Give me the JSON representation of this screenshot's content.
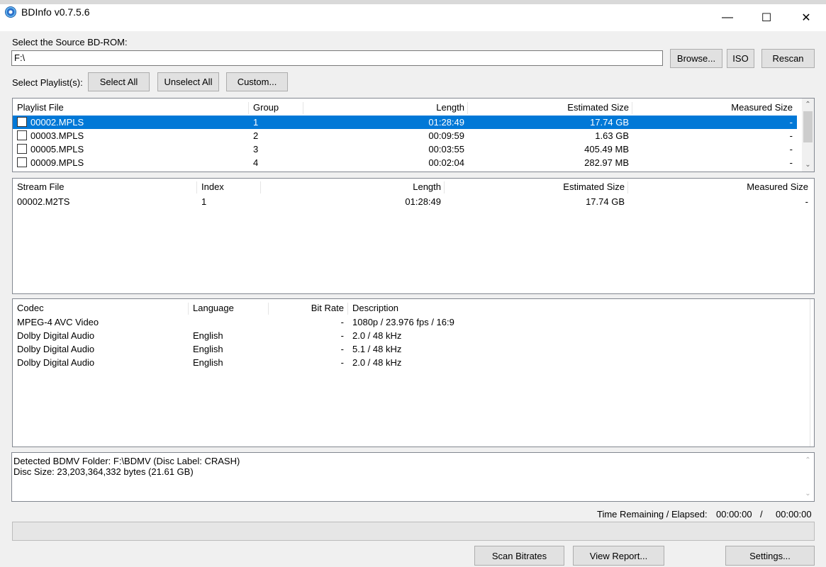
{
  "window": {
    "title": "BDInfo v0.7.5.6",
    "minimize_glyph": "—",
    "maximize_glyph": "☐",
    "close_glyph": "✕"
  },
  "source": {
    "label": "Select the Source BD-ROM:",
    "value": "F:\\",
    "browse_label": "Browse...",
    "iso_label": "ISO",
    "rescan_label": "Rescan"
  },
  "playlist_select": {
    "label": "Select Playlist(s):",
    "select_all_label": "Select All",
    "unselect_all_label": "Unselect All",
    "custom_label": "Custom..."
  },
  "playlists": {
    "columns": [
      "Playlist File",
      "Group",
      "Length",
      "Estimated Size",
      "Measured Size"
    ],
    "rows": [
      {
        "file": "00002.MPLS",
        "group": "1",
        "length": "01:28:49",
        "estimated": "17.74 GB",
        "measured": "-",
        "selected": true
      },
      {
        "file": "00003.MPLS",
        "group": "2",
        "length": "00:09:59",
        "estimated": "1.63 GB",
        "measured": "-",
        "selected": false
      },
      {
        "file": "00005.MPLS",
        "group": "3",
        "length": "00:03:55",
        "estimated": "405.49 MB",
        "measured": "-",
        "selected": false
      },
      {
        "file": "00009.MPLS",
        "group": "4",
        "length": "00:02:04",
        "estimated": "282.97 MB",
        "measured": "-",
        "selected": false
      }
    ]
  },
  "streams": {
    "columns": [
      "Stream File",
      "Index",
      "Length",
      "Estimated Size",
      "Measured Size"
    ],
    "rows": [
      {
        "file": "00002.M2TS",
        "index": "1",
        "length": "01:28:49",
        "estimated": "17.74 GB",
        "measured": "-"
      }
    ]
  },
  "codecs": {
    "columns": [
      "Codec",
      "Language",
      "Bit Rate",
      "Description"
    ],
    "rows": [
      {
        "codec": "MPEG-4 AVC Video",
        "language": "",
        "bitrate": "-",
        "description": "1080p / 23.976 fps / 16:9"
      },
      {
        "codec": "Dolby Digital Audio",
        "language": "English",
        "bitrate": "-",
        "description": "2.0 / 48 kHz"
      },
      {
        "codec": "Dolby Digital Audio",
        "language": "English",
        "bitrate": "-",
        "description": "5.1 / 48 kHz"
      },
      {
        "codec": "Dolby Digital Audio",
        "language": "English",
        "bitrate": "-",
        "description": "2.0 / 48 kHz"
      }
    ]
  },
  "log": {
    "lines": [
      "Detected BDMV Folder: F:\\BDMV (Disc Label: CRASH)",
      "Disc Size: 23,203,364,332 bytes (21.61 GB)"
    ]
  },
  "status": {
    "time_label": "Time Remaining / Elapsed:",
    "remaining": "00:00:00",
    "separator": "/",
    "elapsed": "00:00:00",
    "progress": 0
  },
  "footer": {
    "scan_label": "Scan Bitrates",
    "report_label": "View Report...",
    "settings_label": "Settings..."
  },
  "icons": {
    "scroll_up": "▲",
    "scroll_down": "▼",
    "chevron_up": "⌃",
    "chevron_down": "⌄"
  },
  "colors": {
    "selection": "#0078d7",
    "window_bg": "#f0f0f0"
  }
}
